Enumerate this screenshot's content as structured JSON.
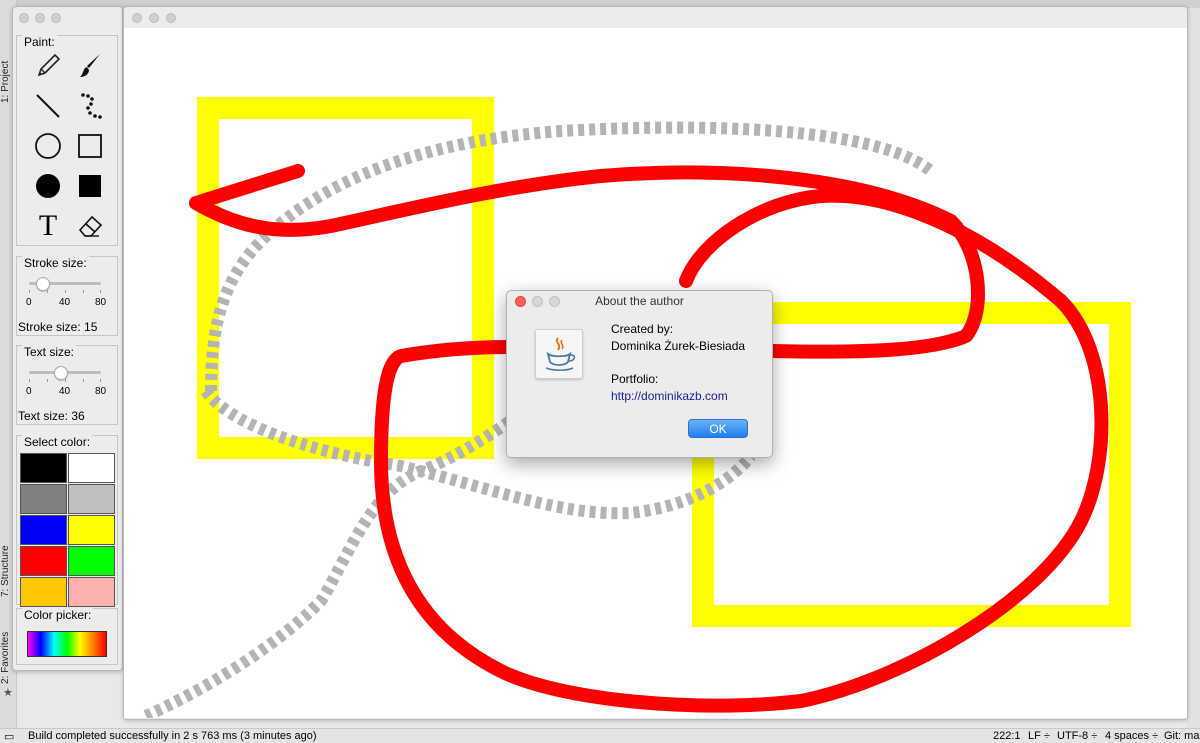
{
  "ide": {
    "left_tabs": [
      "1: Project",
      "7: Structure",
      "2: Favorites"
    ],
    "status_message": "Build completed successfully in 2 s 763 ms (3 minutes ago)",
    "cursor_position": "222:1",
    "line_ending": "LF ÷",
    "encoding": "UTF-8 ÷",
    "indent": "4 spaces ÷",
    "git": "Git: ma"
  },
  "palette": {
    "paint_label": "Paint:",
    "tools": [
      "pencil-icon",
      "brush-icon",
      "line-icon",
      "dotted-line-icon",
      "circle-outline-icon",
      "rectangle-outline-icon",
      "circle-filled-icon",
      "rectangle-filled-icon",
      "text-icon",
      "eraser-icon"
    ],
    "text_tool_glyph": "T",
    "stroke_size": {
      "label": "Stroke size:",
      "ticks": [
        "0",
        "40",
        "80"
      ],
      "value_text": "Stroke size: 15",
      "value": 15,
      "max": 80
    },
    "text_size": {
      "label": "Text size:",
      "ticks": [
        "0",
        "40",
        "80"
      ],
      "value_text": "Text size: 36",
      "value": 36,
      "max": 80
    },
    "select_color_label": "Select color:",
    "colors": [
      "#000000",
      "#ffffff",
      "#808080",
      "#c0c0c0",
      "#0000ff",
      "#ffff00",
      "#ff0000",
      "#00ff00",
      "#ffc800",
      "#ffafaf"
    ],
    "color_picker_label": "Color picker:"
  },
  "canvas": {
    "colors": {
      "yellow": "#ffff00",
      "red": "#ff0000",
      "gray": "#b4b4b4"
    }
  },
  "dialog": {
    "title": "About the author",
    "created_by_label": "Created by:",
    "author": "Dominika Żurek-Biesiada",
    "portfolio_label": "Portfolio:",
    "portfolio_url": "http://dominikazb.com",
    "ok_label": "OK"
  }
}
